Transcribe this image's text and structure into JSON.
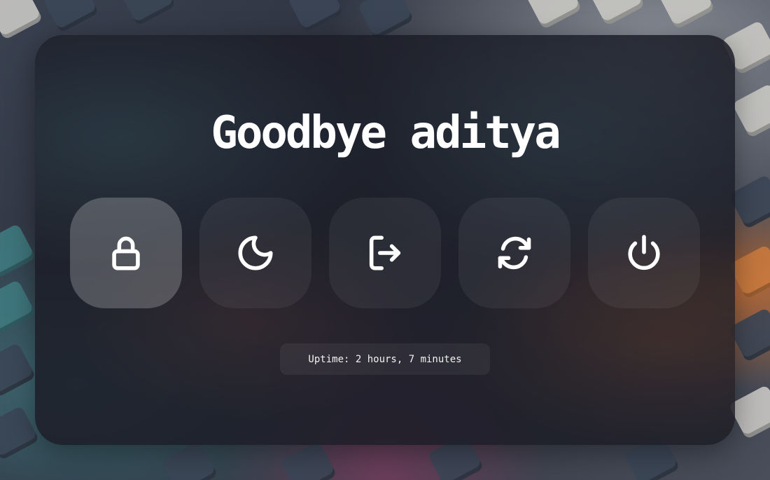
{
  "greeting": "Goodbye aditya",
  "actions": [
    {
      "icon": "lock-icon",
      "label": "Lock",
      "selected": true
    },
    {
      "icon": "moon-icon",
      "label": "Suspend",
      "selected": false
    },
    {
      "icon": "logout-icon",
      "label": "Logout",
      "selected": false
    },
    {
      "icon": "reboot-icon",
      "label": "Reboot",
      "selected": false
    },
    {
      "icon": "power-icon",
      "label": "Shutdown",
      "selected": false
    }
  ],
  "uptime_text": "Uptime: 2 hours, 7 minutes"
}
